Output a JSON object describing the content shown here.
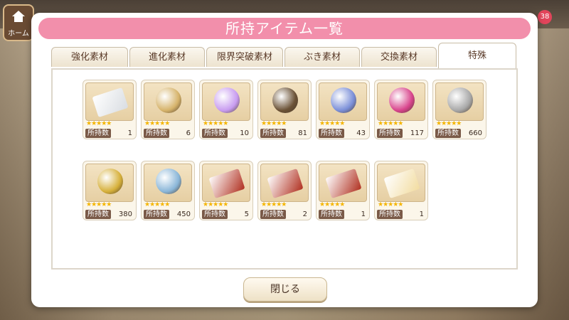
{
  "header": {
    "home_label": "ホーム",
    "badge_count": "38"
  },
  "modal": {
    "title": "所持アイテム一覧",
    "tabs": [
      {
        "label": "強化素材"
      },
      {
        "label": "進化素材"
      },
      {
        "label": "限界突破素材"
      },
      {
        "label": "ぶき素材"
      },
      {
        "label": "交換素材"
      },
      {
        "label": "特殊"
      }
    ],
    "active_tab": "特殊",
    "count_label": "所持数",
    "close_label": "閉じる"
  },
  "items": [
    {
      "name": "ticket-silver-icon",
      "count": "1",
      "stars": 5,
      "color": "#d9dde2"
    },
    {
      "name": "dreamcatcher-icon",
      "count": "6",
      "stars": 5,
      "color": "#d6b36a"
    },
    {
      "name": "rainbow-crystal-icon",
      "count": "10",
      "stars": 5,
      "color": "#c89cf0"
    },
    {
      "name": "bronze-medal-icon",
      "count": "81",
      "stars": 5,
      "color": "#6b5236"
    },
    {
      "name": "blue-medal-icon",
      "count": "43",
      "stars": 5,
      "color": "#7b8fd8"
    },
    {
      "name": "pink-medal-icon",
      "count": "117",
      "stars": 5,
      "color": "#d8448c"
    },
    {
      "name": "silver-figure-icon",
      "count": "660",
      "stars": 5,
      "color": "#a8a8a8"
    },
    {
      "name": "gold-figure-icon",
      "count": "380",
      "stars": 5,
      "color": "#d6b03a"
    },
    {
      "name": "blue-tin-icon",
      "count": "450",
      "stars": 5,
      "color": "#8ab6d8"
    },
    {
      "name": "red-ticket-icon",
      "count": "5",
      "stars": 5,
      "color": "#b03020"
    },
    {
      "name": "red-ticket-icon",
      "count": "2",
      "stars": 5,
      "color": "#b03020"
    },
    {
      "name": "red-ticket-icon",
      "count": "1",
      "stars": 5,
      "color": "#b03020"
    },
    {
      "name": "portrait-card-icon",
      "count": "1",
      "stars": 5,
      "color": "#f2dca0"
    }
  ]
}
